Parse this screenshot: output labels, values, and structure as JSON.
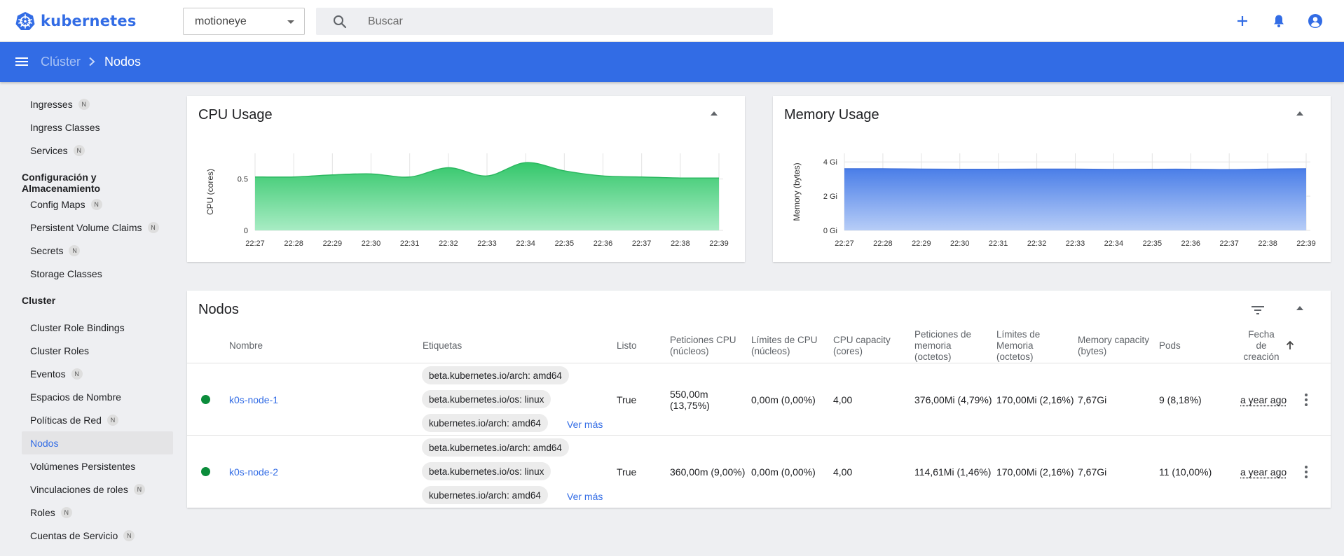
{
  "app": {
    "title": "kubernetes"
  },
  "topbar": {
    "namespace": "motioneye",
    "search_placeholder": "Buscar",
    "icons": [
      "add-icon",
      "bell-icon",
      "account-icon"
    ]
  },
  "breadcrumb": {
    "parent": "Clúster",
    "current": "Nodos"
  },
  "sidebar": {
    "items_top": [
      {
        "label": "Ingresses",
        "badge": "N"
      },
      {
        "label": "Ingress Classes",
        "badge": ""
      },
      {
        "label": "Services",
        "badge": "N"
      }
    ],
    "section_config": "Configuración y Almacenamiento",
    "items_config": [
      {
        "label": "Config Maps",
        "badge": "N"
      },
      {
        "label": "Persistent Volume Claims",
        "badge": "N"
      },
      {
        "label": "Secrets",
        "badge": "N"
      },
      {
        "label": "Storage Classes",
        "badge": ""
      }
    ],
    "section_cluster": "Cluster",
    "items_cluster": [
      {
        "label": "Cluster Role Bindings",
        "badge": ""
      },
      {
        "label": "Cluster Roles",
        "badge": ""
      },
      {
        "label": "Eventos",
        "badge": "N"
      },
      {
        "label": "Espacios de Nombre",
        "badge": ""
      },
      {
        "label": "Políticas de Red",
        "badge": "N"
      },
      {
        "label": "Nodos",
        "badge": ""
      },
      {
        "label": "Volúmenes Persistentes",
        "badge": ""
      },
      {
        "label": "Vinculaciones de roles",
        "badge": "N"
      },
      {
        "label": "Roles",
        "badge": "N"
      },
      {
        "label": "Cuentas de Servicio",
        "badge": "N"
      }
    ],
    "active": "Nodos"
  },
  "cpu_card": {
    "title": "CPU Usage"
  },
  "memory_card": {
    "title": "Memory Usage"
  },
  "chart_data": [
    {
      "type": "area",
      "title": "CPU Usage",
      "xlabel": "",
      "ylabel": "CPU (cores)",
      "x": [
        "22:27",
        "22:28",
        "22:29",
        "22:30",
        "22:31",
        "22:32",
        "22:33",
        "22:34",
        "22:35",
        "22:36",
        "22:37",
        "22:38",
        "22:39"
      ],
      "y_ticks": [
        "0",
        "0.5"
      ],
      "ylim": [
        0,
        0.75
      ],
      "series": [
        {
          "values": [
            0.52,
            0.52,
            0.54,
            0.55,
            0.52,
            0.61,
            0.53,
            0.66,
            0.58,
            0.53,
            0.52,
            0.51,
            0.51
          ]
        }
      ],
      "color": "#2ecc71"
    },
    {
      "type": "area",
      "title": "Memory Usage",
      "xlabel": "",
      "ylabel": "Memory (bytes)",
      "x": [
        "22:27",
        "22:28",
        "22:29",
        "22:30",
        "22:31",
        "22:32",
        "22:33",
        "22:34",
        "22:35",
        "22:36",
        "22:37",
        "22:38",
        "22:39"
      ],
      "y_ticks": [
        "0 Gi",
        "2 Gi",
        "4 Gi"
      ],
      "ylim": [
        0,
        4.5
      ],
      "series": [
        {
          "values": [
            3.6,
            3.6,
            3.58,
            3.57,
            3.57,
            3.58,
            3.58,
            3.56,
            3.57,
            3.57,
            3.55,
            3.58,
            3.6
          ]
        }
      ],
      "color": "#4a7ee8"
    }
  ],
  "nodes": {
    "title": "Nodos",
    "columns": {
      "name": "Nombre",
      "labels": "Etiquetas",
      "ready": "Listo",
      "cpu_req_1": "Peticiones CPU",
      "cpu_req_2": "(núcleos)",
      "cpu_lim_1": "Límites de CPU",
      "cpu_lim_2": "(núcleos)",
      "cpu_cap_1": "CPU capacity",
      "cpu_cap_2": "(cores)",
      "mem_req_1": "Peticiones de",
      "mem_req_2": "memoria",
      "mem_req_3": "(octetos)",
      "mem_lim_1": "Límites de",
      "mem_lim_2": "Memoria",
      "mem_lim_3": "(octetos)",
      "mem_cap_1": "Memory capacity",
      "mem_cap_2": "(bytes)",
      "pods": "Pods",
      "created_1": "Fecha",
      "created_2": "de",
      "created_3": "creación"
    },
    "rows": [
      {
        "name": "k0s-node-1",
        "labels": [
          "beta.kubernetes.io/arch: amd64",
          "beta.kubernetes.io/os: linux",
          "kubernetes.io/arch: amd64"
        ],
        "more": "Ver más",
        "ready": "True",
        "cpu_req_1": "550,00m",
        "cpu_req_2": "(13,75%)",
        "cpu_lim": "0,00m (0,00%)",
        "cpu_cap": "4,00",
        "mem_req": "376,00Mi (4,79%)",
        "mem_lim": "170,00Mi (2,16%)",
        "mem_cap": "7,67Gi",
        "pods": "9 (8,18%)",
        "created": "a year ago"
      },
      {
        "name": "k0s-node-2",
        "labels": [
          "beta.kubernetes.io/arch: amd64",
          "beta.kubernetes.io/os: linux",
          "kubernetes.io/arch: amd64"
        ],
        "more": "Ver más",
        "ready": "True",
        "cpu_req_1": "360,00m (9,00%)",
        "cpu_req_2": "",
        "cpu_lim": "0,00m (0,00%)",
        "cpu_cap": "4,00",
        "mem_req": "114,61Mi (1,46%)",
        "mem_lim": "170,00Mi (2,16%)",
        "mem_cap": "7,67Gi",
        "pods": "11 (10,00%)",
        "created": "a year ago"
      }
    ]
  }
}
